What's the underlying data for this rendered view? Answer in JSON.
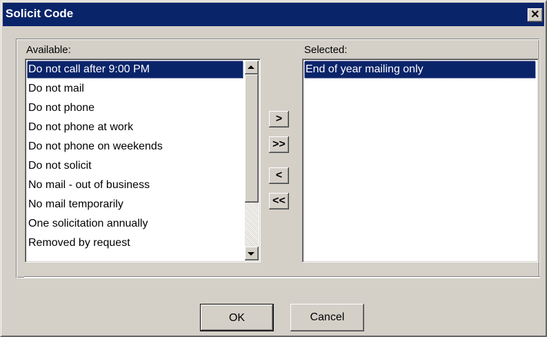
{
  "dialog": {
    "title": "Solicit Code",
    "close_glyph": "✕"
  },
  "available": {
    "label": "Available:",
    "items": [
      "Do not call after 9:00 PM",
      "Do not mail",
      "Do not phone",
      "Do not phone at work",
      "Do not phone on weekends",
      "Do not solicit",
      "No mail - out of business",
      "No mail temporarily",
      "One solicitation annually",
      "Removed by request"
    ],
    "selected_index": 0
  },
  "selected": {
    "label": "Selected:",
    "items": [
      "End of year mailing only"
    ],
    "selected_index": 0
  },
  "move_buttons": {
    "add": ">",
    "add_all": ">>",
    "remove": "<",
    "remove_all": "<<"
  },
  "buttons": {
    "ok": "OK",
    "cancel": "Cancel"
  }
}
